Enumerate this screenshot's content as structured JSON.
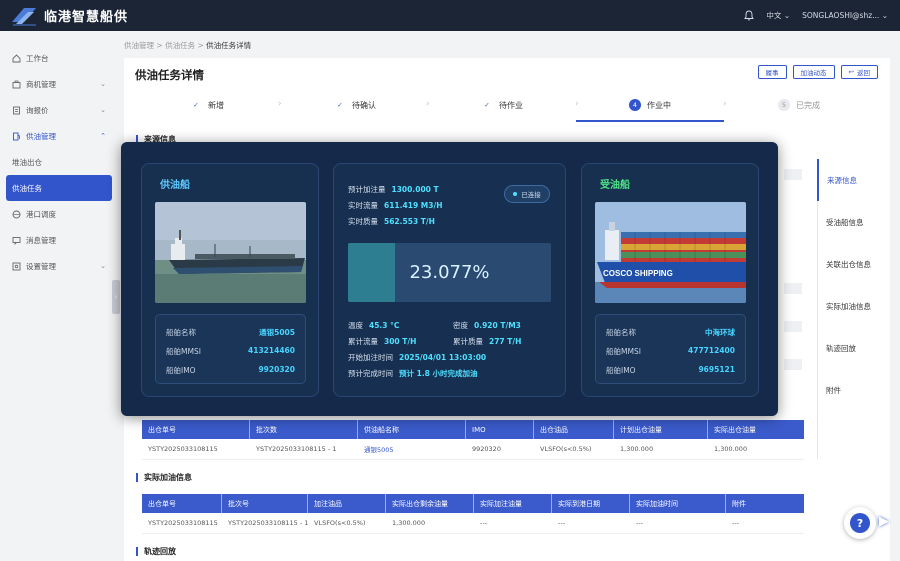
{
  "app": {
    "title": "临港智慧船供"
  },
  "topbar": {
    "lang": "中文",
    "user": "SONGLAOSHI@shz..."
  },
  "sidebar": {
    "items": [
      {
        "label": "工作台",
        "icon": "home-icon"
      },
      {
        "label": "商机管理",
        "icon": "briefcase-icon"
      },
      {
        "label": "询报价",
        "icon": "quote-icon"
      },
      {
        "label": "供油管理",
        "icon": "fuel-icon"
      },
      {
        "label": "堆油出仓"
      },
      {
        "label": "供油任务"
      },
      {
        "label": "港口调度",
        "icon": "globe-icon"
      },
      {
        "label": "消息管理",
        "icon": "message-icon"
      },
      {
        "label": "设置管理",
        "icon": "settings-icon"
      }
    ]
  },
  "breadcrumb": {
    "l1": "供油管理",
    "l2": "供油任务",
    "l3": "供油任务详情",
    "sep": ">"
  },
  "page": {
    "title": "供油任务详情",
    "btn_history": "履事",
    "btn_dynamic": "加油动态",
    "btn_back": "返回"
  },
  "steps": [
    {
      "label": "新增",
      "mark": "✓"
    },
    {
      "label": "待确认",
      "mark": "✓"
    },
    {
      "label": "待作业",
      "mark": "✓"
    },
    {
      "label": "作业中",
      "mark": "4"
    },
    {
      "label": "已完成",
      "mark": "5"
    }
  ],
  "sections": {
    "source": "来源信息",
    "actual": "实际加油信息",
    "track": "轨迹回放"
  },
  "anchors": [
    "来源信息",
    "受油船信息",
    "关联出仓信息",
    "实际加油信息",
    "轨迹回放",
    "附件"
  ],
  "outbound_table": {
    "headers": [
      "出仓单号",
      "批次数",
      "供油船名称",
      "IMO",
      "出仓油品",
      "计划出仓油量",
      "实际出仓油量"
    ],
    "row": [
      "YSTY2025033108115",
      "YSTY2025033108115 - 1",
      "通银5005",
      "9920320",
      "VLSFO(s<0.5%)",
      "1,300.000",
      "1,300.000"
    ]
  },
  "actual_table": {
    "headers": [
      "出仓单号",
      "批次号",
      "加注油品",
      "实际出仓剩余油量",
      "实际加注油量",
      "实际到港日期",
      "实际加油时间",
      "附件"
    ],
    "row": [
      "YSTY2025033108115",
      "YSTY2025033108115 - 1",
      "VLSFO(s<0.5%)",
      "1,300.000",
      "---",
      "---",
      "---",
      "---"
    ]
  },
  "modal": {
    "supply": {
      "title": "供油船",
      "name_k": "船舶名称",
      "name_v": "通银5005",
      "mmsi_k": "船舶MMSI",
      "mmsi_v": "413214460",
      "imo_k": "船舶IMO",
      "imo_v": "9920320"
    },
    "receive": {
      "title": "受油船",
      "name_k": "船舶名称",
      "name_v": "中海环球",
      "mmsi_k": "船舶MMSI",
      "mmsi_v": "477712400",
      "imo_k": "船舶IMO",
      "imo_v": "9695121",
      "hull_text": "COSCO SHIPPING"
    },
    "status": "已连接",
    "plan_k": "预计加注量",
    "plan_v": "1300.000 T",
    "flow_k": "实时流量",
    "flow_v": "611.419 M3/H",
    "mass_k": "实时质量",
    "mass_v": "562.553 T/H",
    "progress_text": "23.077%",
    "progress": 0.23077,
    "temp_k": "温度",
    "temp_v": "45.3 °C",
    "dens_k": "密度",
    "dens_v": "0.920 T/M3",
    "cumflow_k": "累计流量",
    "cumflow_v": "300 T/H",
    "cummass_k": "累计质量",
    "cummass_v": "277 T/H",
    "start_k": "开始加注时间",
    "start_v": "2025/04/01 13:03:00",
    "eta_k": "预计完成时间",
    "eta_v": "预计 1.8 小时完成加油"
  },
  "help": {
    "label": "?"
  }
}
